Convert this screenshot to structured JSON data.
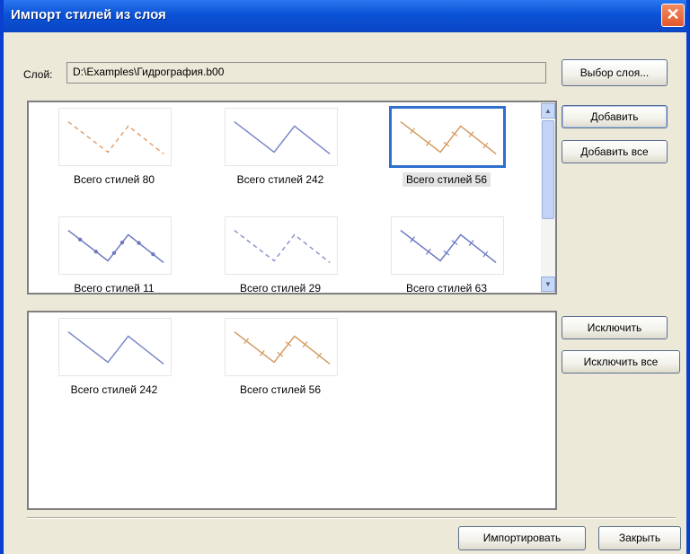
{
  "window": {
    "title": "Импорт стилей из слоя",
    "close_glyph": "✕"
  },
  "layer": {
    "label": "Слой:",
    "path": "D:\\Examples\\Гидрография.b00",
    "choose_button": "Выбор слоя..."
  },
  "buttons": {
    "add": "Добавить",
    "add_all": "Добавить все",
    "exclude": "Исключить",
    "exclude_all": "Исключить все",
    "import": "Импортировать",
    "close": "Закрыть"
  },
  "available_styles": [
    {
      "caption": "Всего стилей 80",
      "color": "#e0a070",
      "pattern": "dashed",
      "selected": false
    },
    {
      "caption": "Всего стилей 242",
      "color": "#7a86c8",
      "pattern": "solid",
      "selected": false
    },
    {
      "caption": "Всего стилей 56",
      "color": "#d49a60",
      "pattern": "ticks",
      "selected": true
    },
    {
      "caption": "Всего стилей 11",
      "color": "#6b78c0",
      "pattern": "markers",
      "selected": false
    },
    {
      "caption": "Всего стилей 29",
      "color": "#8a93cc",
      "pattern": "dashed",
      "selected": false
    },
    {
      "caption": "Всего стилей 63",
      "color": "#6b78c0",
      "pattern": "ticks",
      "selected": false
    }
  ],
  "selected_styles": [
    {
      "caption": "Всего стилей 242",
      "color": "#7a86c8",
      "pattern": "solid"
    },
    {
      "caption": "Всего стилей 56",
      "color": "#d49a60",
      "pattern": "ticks"
    }
  ],
  "scrollbar": {
    "up_glyph": "▲",
    "down_glyph": "▼"
  }
}
